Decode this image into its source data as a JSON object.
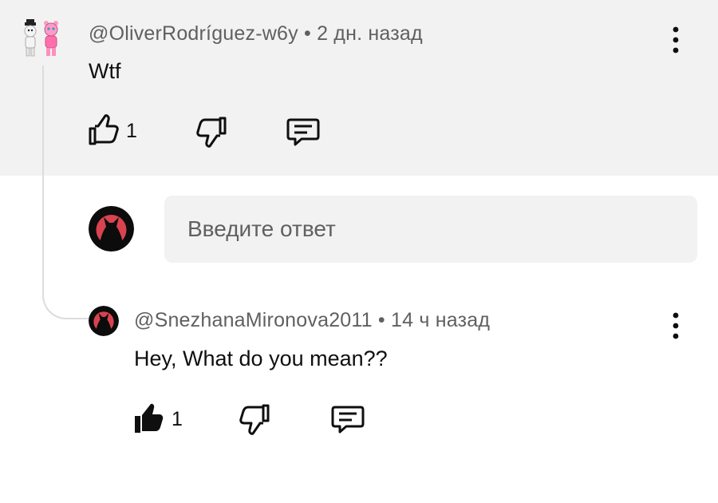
{
  "comment": {
    "author": "@OliverRodríguez-w6y",
    "separator": "•",
    "time": "2 дн. назад",
    "text": "Wtf",
    "likes": "1",
    "icons": {
      "like": "thumbs-up-outline-icon",
      "dislike": "thumbs-down-outline-icon",
      "reply": "reply-comment-icon",
      "menu": "more-vertical-icon"
    }
  },
  "reply_input": {
    "placeholder": "Введите ответ"
  },
  "reply": {
    "author": "@SnezhanaMironova2011",
    "separator": "•",
    "time": "14 ч назад",
    "text": "Hey, What do you mean??",
    "likes": "1",
    "liked": true,
    "icons": {
      "like": "thumbs-up-filled-icon",
      "dislike": "thumbs-down-outline-icon",
      "reply": "reply-comment-icon",
      "menu": "more-vertical-icon"
    }
  },
  "colors": {
    "band_background": "#f2f2f2",
    "meta_text": "#606060",
    "primary_text": "#0f0f0f",
    "avatar_accent": "#d8434f"
  }
}
